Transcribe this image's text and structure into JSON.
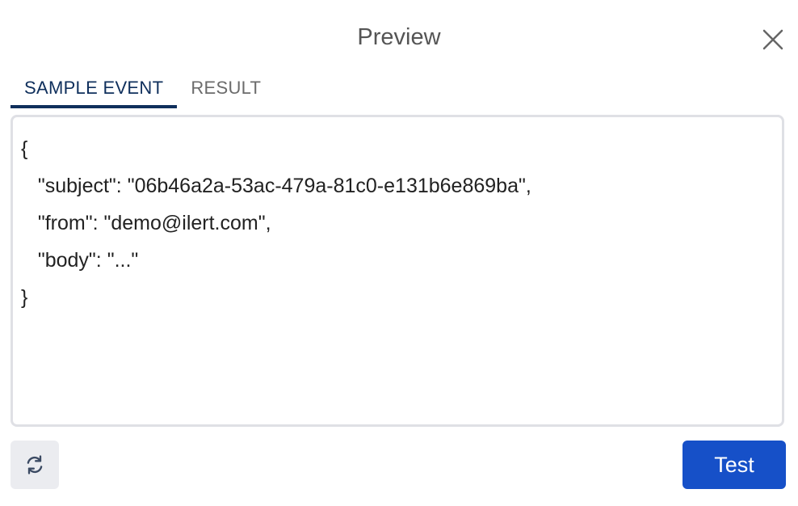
{
  "header": {
    "title": "Preview",
    "close_icon": "close-icon"
  },
  "tabs": [
    {
      "label": "SAMPLE EVENT",
      "active": true
    },
    {
      "label": "RESULT",
      "active": false
    }
  ],
  "editor": {
    "lines": [
      "{",
      "   \"subject\": \"06b46a2a-53ac-479a-81c0-e131b6e869ba\",",
      "   \"from\": \"demo@ilert.com\",",
      "   \"body\": \"...\"",
      "}"
    ]
  },
  "footer": {
    "refresh_icon": "refresh-icon",
    "test_label": "Test"
  },
  "colors": {
    "accent": "#1650c8",
    "tab_active": "#0f2f5c",
    "border": "#dfe0e5"
  }
}
